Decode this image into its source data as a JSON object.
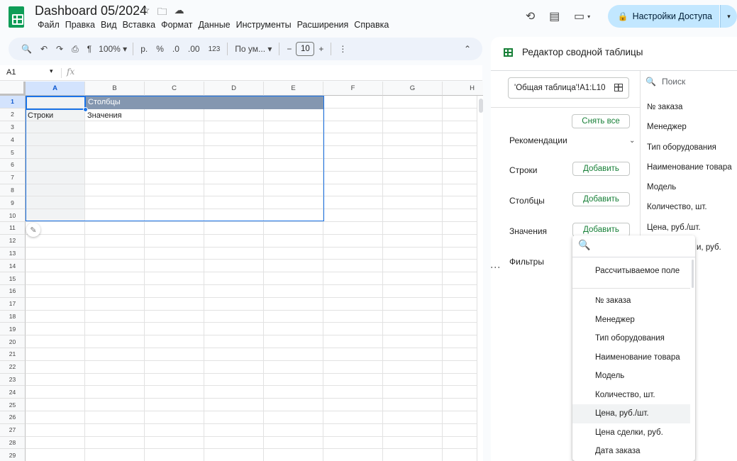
{
  "header": {
    "title": "Dashboard 05/2024",
    "title_icons": [
      "star-icon",
      "move-folder-icon",
      "cloud-status-icon"
    ],
    "menu": [
      "Файл",
      "Правка",
      "Вид",
      "Вставка",
      "Формат",
      "Данные",
      "Инструменты",
      "Расширения",
      "Справка"
    ],
    "share_label": "Настройки Доступа"
  },
  "toolbar": {
    "zoom": "100%",
    "currency": "р.",
    "percent": "%",
    "dec_less": ".0",
    "dec_more": ".00",
    "number_format": "123",
    "font": "По ум...",
    "minus": "−",
    "font_size": "10",
    "plus": "+",
    "more": "⋮"
  },
  "formula_bar": {
    "cell_ref": "A1",
    "fx": "fx"
  },
  "grid": {
    "columns": [
      "A",
      "B",
      "C",
      "D",
      "E",
      "F",
      "G",
      "H"
    ],
    "rows": [
      "1",
      "2",
      "3",
      "4",
      "5",
      "6",
      "7",
      "8",
      "9",
      "10",
      "11",
      "12",
      "13",
      "14",
      "15",
      "16",
      "17",
      "18",
      "19",
      "20",
      "21",
      "22",
      "23",
      "24",
      "25",
      "26",
      "27",
      "28",
      "29"
    ],
    "b1": "Столбцы",
    "a2": "Строки",
    "b2": "Значения"
  },
  "panel": {
    "title": "Редактор сводной таблицы",
    "range": "'Общая таблица'!A1:L10",
    "clear_all": "Снять все",
    "recommendations": "Рекомендации",
    "rows_label": "Строки",
    "columns_label": "Столбцы",
    "values_label": "Значения",
    "filters_label": "Фильтры",
    "add": "Добавить",
    "search_placeholder": "Поиск",
    "fields": [
      "№ заказа",
      "Менеджер",
      "Тип оборудования",
      "Наименование товара",
      "Модель",
      "Количество, шт.",
      "Цена, руб./шт."
    ],
    "hidden_field_tail": "и, руб."
  },
  "dropdown": {
    "calc_field": "Рассчитываемое поле",
    "items": [
      "№ заказа",
      "Менеджер",
      "Тип оборудования",
      "Наименование товара",
      "Модель",
      "Количество, шт.",
      "Цена, руб./шт.",
      "Цена сделки, руб.",
      "Дата заказа"
    ],
    "highlighted": "Цена, руб./шт."
  }
}
